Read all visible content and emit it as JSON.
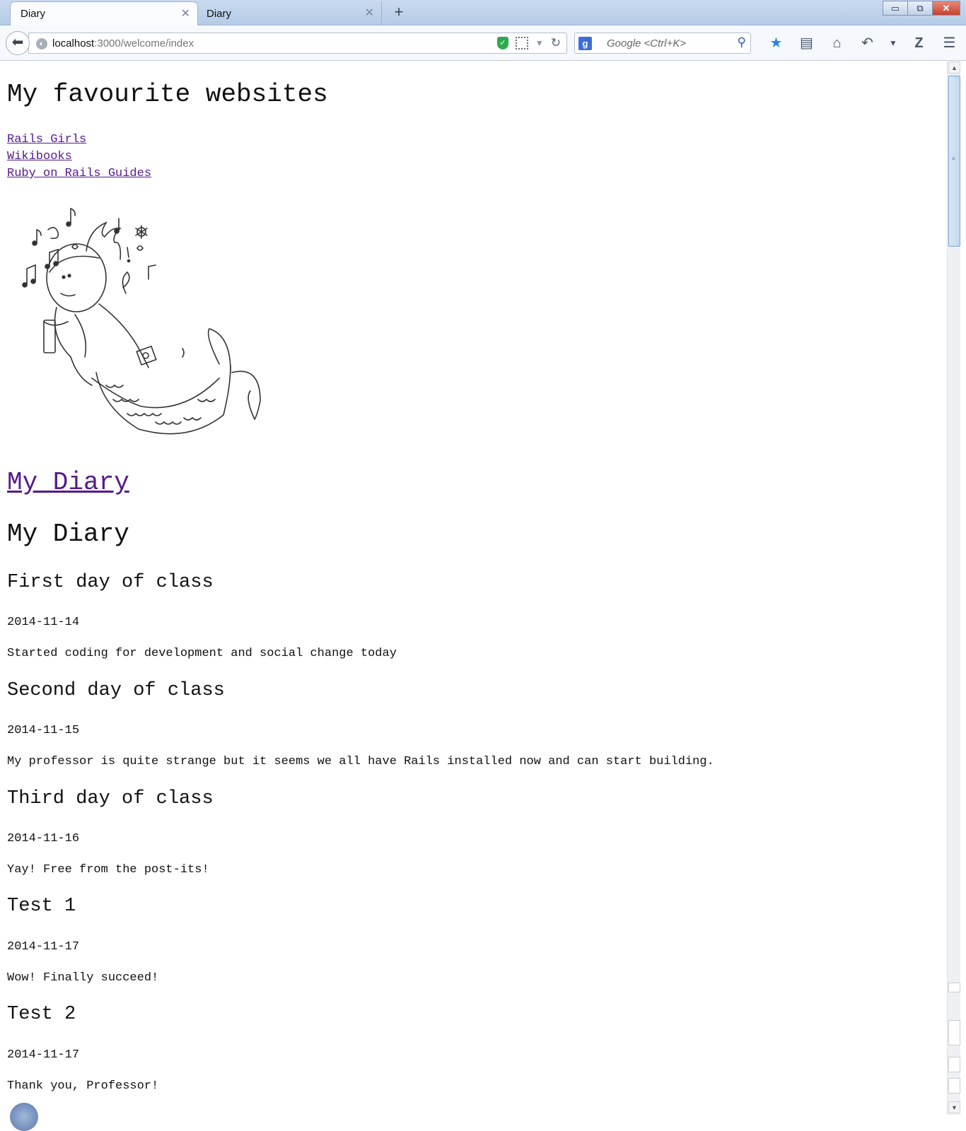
{
  "tabs": [
    {
      "title": "Diary",
      "active": true
    },
    {
      "title": "Diary",
      "active": false
    }
  ],
  "window_controls": {
    "minimize": "▭",
    "restore": "⧉",
    "close": "✕"
  },
  "address_bar": {
    "host": "localhost",
    "rest": ":3000/welcome/index"
  },
  "search_bar": {
    "placeholder": "Google <Ctrl+K>"
  },
  "toolbar_icons": [
    "bookmark-star-icon",
    "reading-list-icon",
    "home-icon",
    "undo-icon",
    "dropdown-icon",
    "zotero-icon",
    "menu-icon"
  ],
  "page": {
    "heading": "My favourite websites",
    "links": [
      "Rails Girls",
      "Wikibooks",
      "Ruby on Rails Guides"
    ],
    "diary_link": "My Diary",
    "diary_heading": "My Diary",
    "entries": [
      {
        "title": "First day of class",
        "date": "2014-11-14",
        "body": "Started coding for development and social change today"
      },
      {
        "title": "Second day of class",
        "date": "2014-11-15",
        "body": "My professor is quite strange but it seems we all have Rails installed now and can start building."
      },
      {
        "title": "Third day of class",
        "date": "2014-11-16",
        "body": "Yay! Free from the post-its!"
      },
      {
        "title": "Test 1",
        "date": "2014-11-17",
        "body": "Wow! Finally succeed!"
      },
      {
        "title": "Test 2",
        "date": "2014-11-17",
        "body": "Thank you, Professor!"
      }
    ]
  },
  "colors": {
    "link_visited": "#551a8b",
    "tab_bar": "#c9daf0",
    "close_button": "#c7412c"
  }
}
